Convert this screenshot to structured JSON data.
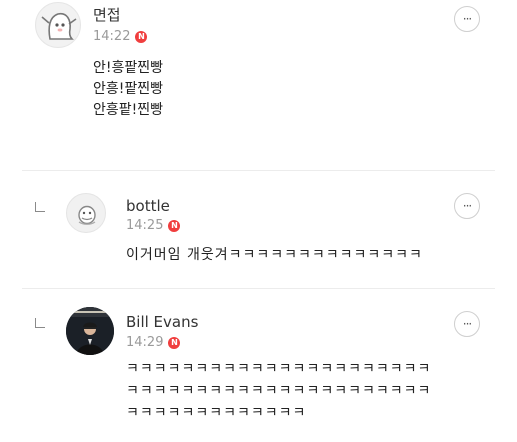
{
  "comments": [
    {
      "author": "면접",
      "time": "14:22",
      "badge": "N",
      "lines": [
        "안!흥팥찐빵",
        "안흥!팥찐빵",
        "안흥팥!찐빵"
      ],
      "more_icon": "more-horizontal-icon"
    },
    {
      "author": "bottle",
      "time": "14:25",
      "badge": "N",
      "lines": [
        "이거머임 개웃겨ㅋㅋㅋㅋㅋㅋㅋㅋㅋㅋㅋㅋㅋㅋ"
      ],
      "reply": true
    },
    {
      "author": "Bill Evans",
      "time": "14:29",
      "badge": "N",
      "lines": [
        "ㅋㅋㅋㅋㅋㅋㅋㅋㅋㅋㅋㅋㅋㅋㅋㅋㅋㅋㅋㅋㅋㅋ",
        "ㅋㅋㅋㅋㅋㅋㅋㅋㅋㅋㅋㅋㅋㅋㅋㅋㅋㅋㅋㅋㅋㅋ",
        "ㅋㅋㅋㅋㅋㅋㅋㅋㅋㅋㅋㅋㅋ"
      ],
      "reply": true
    }
  ],
  "more_label": "···",
  "colors": {
    "badge": "#f03e3e",
    "divider": "#ececec",
    "time": "#9a9a9a"
  }
}
